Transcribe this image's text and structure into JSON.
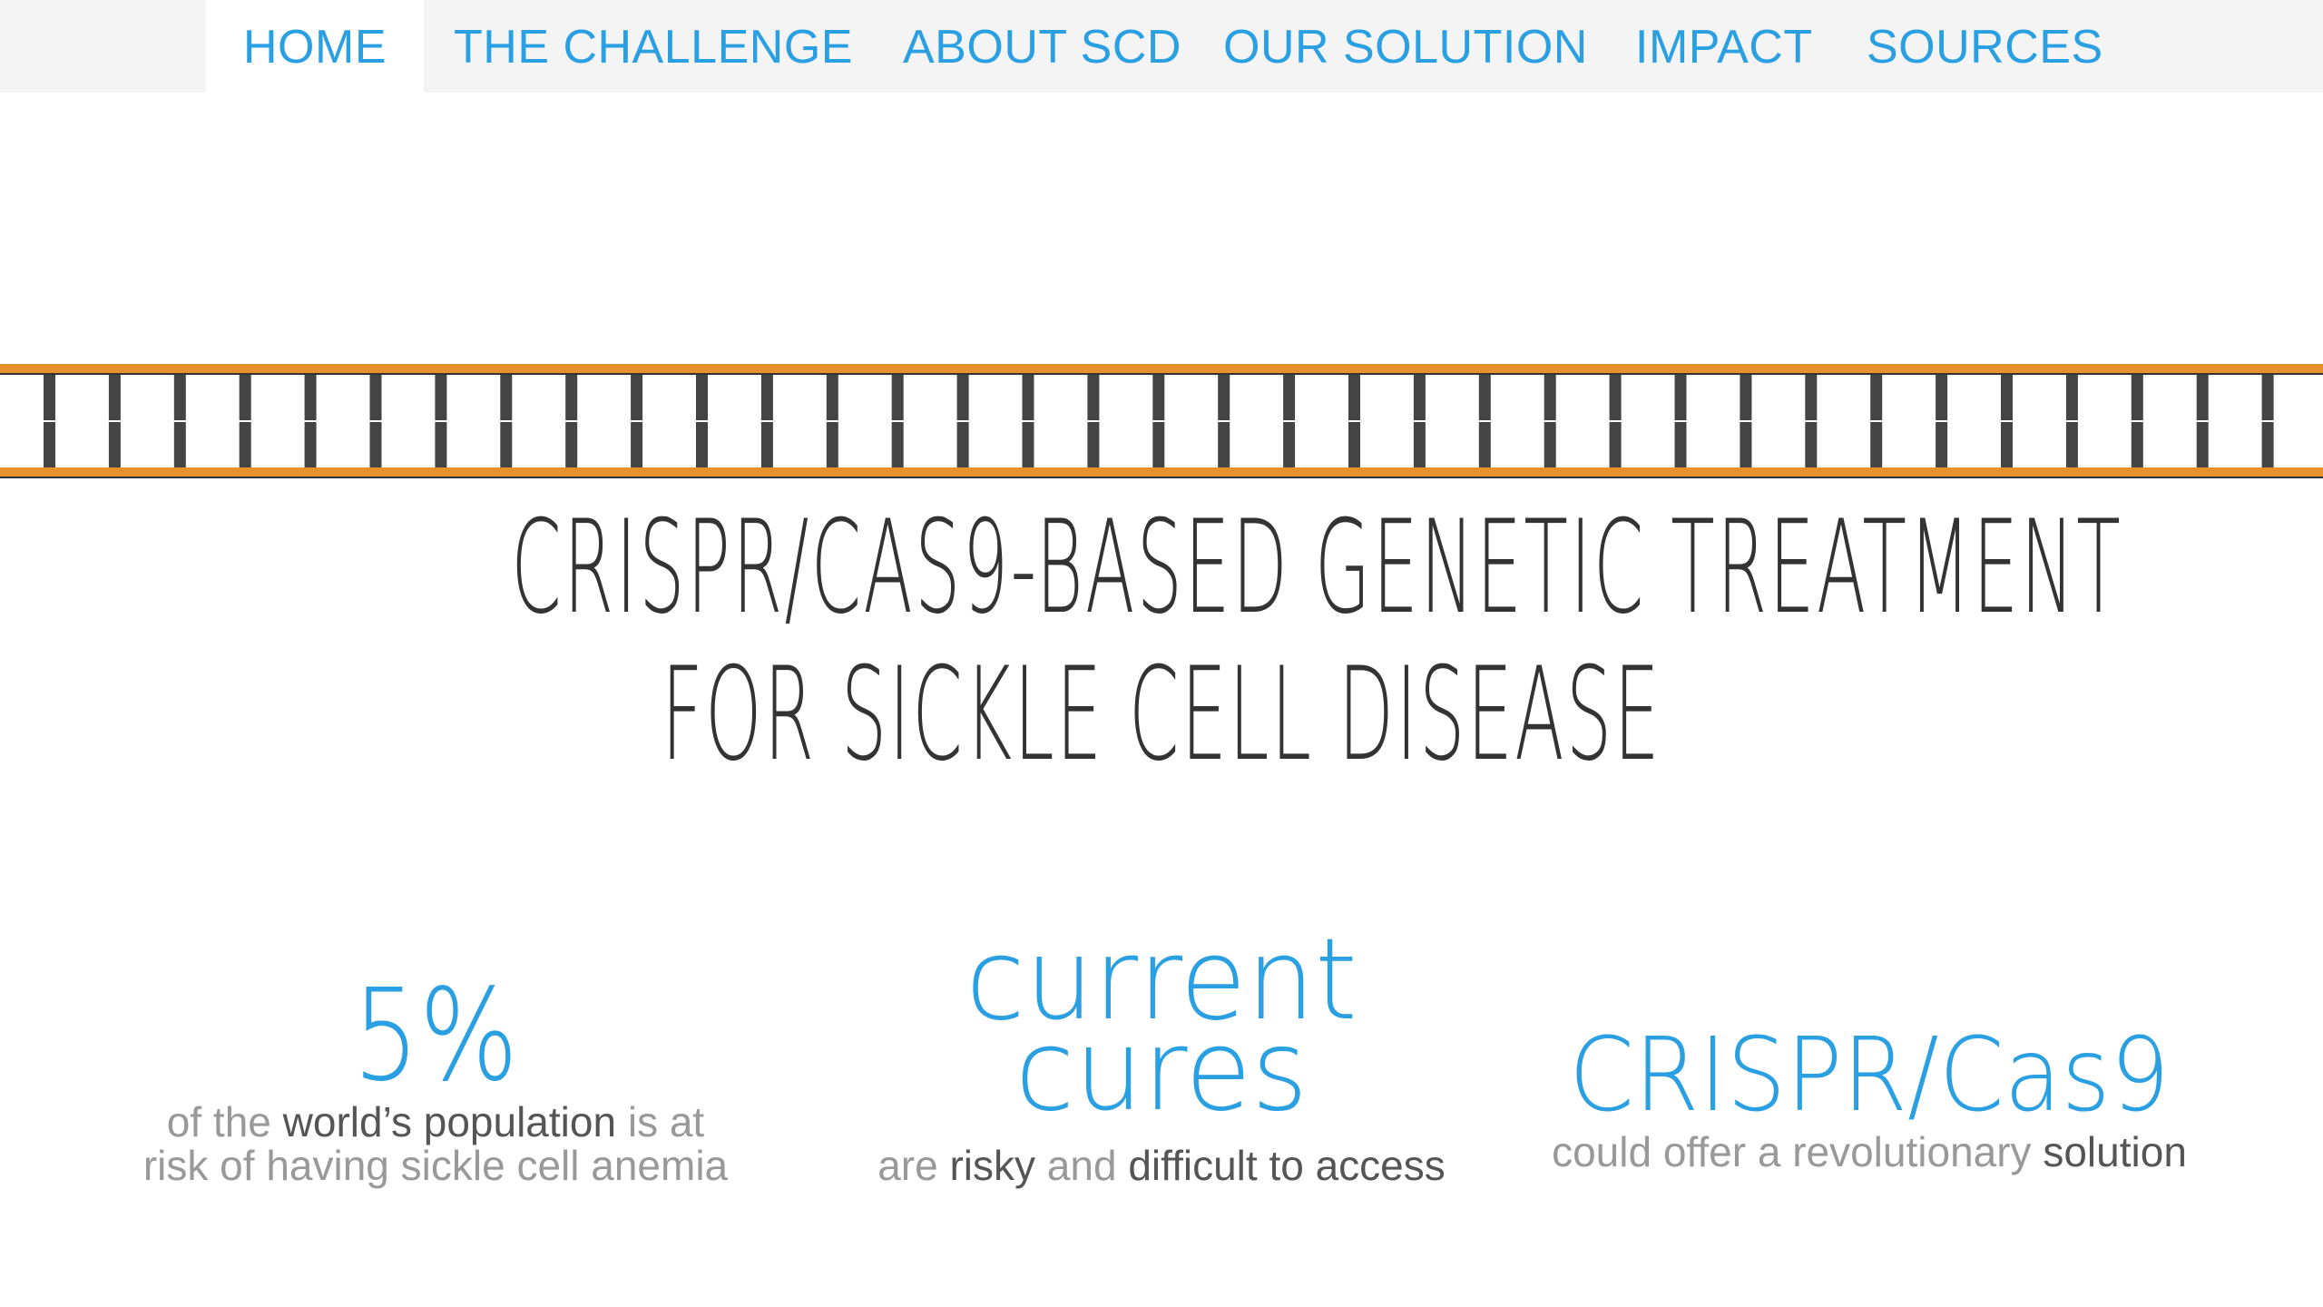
{
  "nav": {
    "items": [
      {
        "label": "HOME",
        "active": true
      },
      {
        "label": "THE CHALLENGE",
        "active": false
      },
      {
        "label": "ABOUT SCD",
        "active": false
      },
      {
        "label": "OUR SOLUTION",
        "active": false
      },
      {
        "label": "IMPACT",
        "active": false
      },
      {
        "label": "SOURCES",
        "active": false
      }
    ]
  },
  "hero": {
    "line1": "CRISPR/CAS9-BASED GENETIC TREATMENT",
    "line2": "FOR SICKLE CELL DISEASE"
  },
  "stats": [
    {
      "big": "5%",
      "desc_line1": [
        {
          "text": "of the ",
          "em": false
        },
        {
          "text": "world’s population",
          "em": true
        },
        {
          "text": " is at",
          "em": false
        }
      ],
      "desc_line2": [
        {
          "text": "risk of having sickle cell anemia",
          "em": false
        }
      ]
    },
    {
      "big_line1": "current",
      "big_line2": "cures",
      "desc_line1": [
        {
          "text": "are ",
          "em": false
        },
        {
          "text": "risky",
          "em": true
        },
        {
          "text": " and ",
          "em": false
        },
        {
          "text": "difficult to access",
          "em": true
        }
      ]
    },
    {
      "big": "CRISPR/Cas9",
      "desc_line1": [
        {
          "text": "could offer a revolutionary ",
          "em": false
        },
        {
          "text": "solution",
          "em": true
        }
      ]
    }
  ],
  "colors": {
    "accent": "#2aa0e2",
    "dna_strand": "#e6912e",
    "dna_rung": "#444444",
    "title_text": "#333333",
    "muted_text": "#999999",
    "emphasis_text": "#555555",
    "nav_bg": "#f4f4f4"
  }
}
